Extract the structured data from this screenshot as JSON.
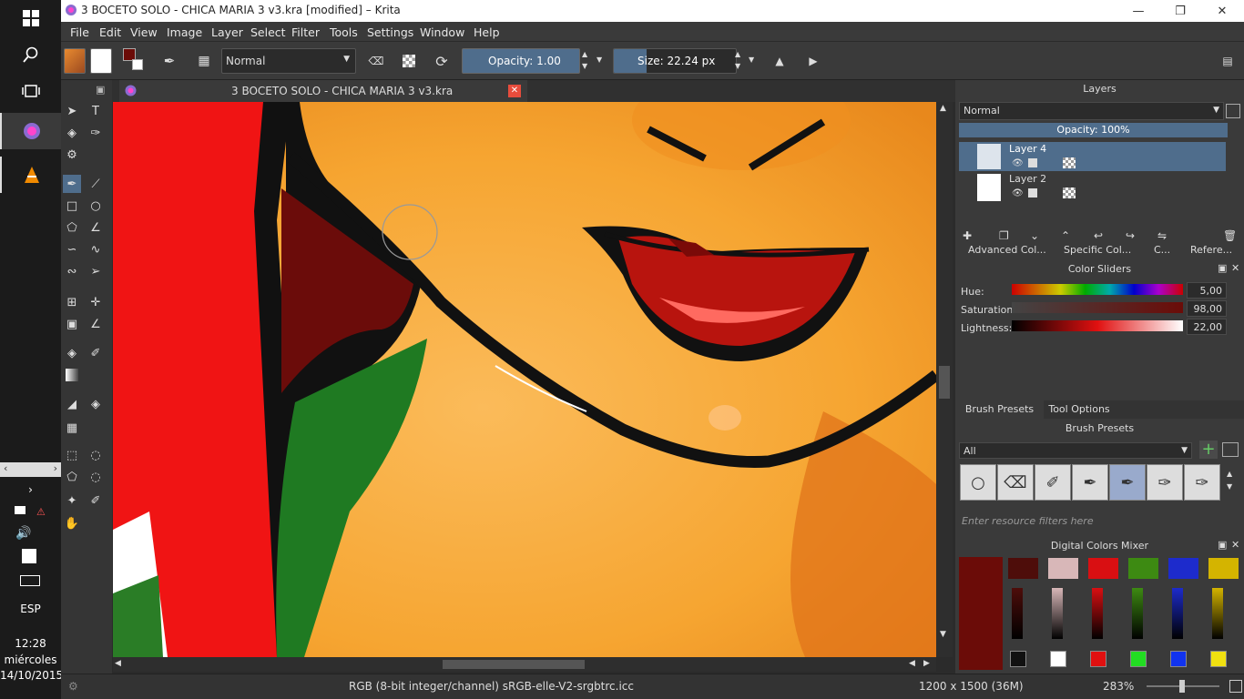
{
  "window": {
    "title": "3 BOCETO SOLO - CHICA MARIA 3 v3.kra [modified] – Krita"
  },
  "menubar": {
    "items": [
      "File",
      "Edit",
      "View",
      "Image",
      "Layer",
      "Select",
      "Filter",
      "Tools",
      "Settings",
      "Window",
      "Help"
    ]
  },
  "toolbar": {
    "blend_mode": "Normal",
    "opacity_label": "Opacity:",
    "opacity_value": "1.00",
    "size_label": "Size:",
    "size_value": "22.24 px"
  },
  "document_tab": {
    "label": "3 BOCETO SOLO - CHICA MARIA 3 v3.kra"
  },
  "layers_panel": {
    "title": "Layers",
    "blend_mode": "Normal",
    "opacity": "Opacity:  100%",
    "layers": [
      {
        "name": "Layer 4",
        "selected": true
      },
      {
        "name": "Layer 2",
        "selected": false
      }
    ],
    "tabs": [
      "Advanced Col...",
      "Specific Col...",
      "C...",
      "Refere..."
    ]
  },
  "color_sliders": {
    "title": "Color Sliders",
    "hue_label": "Hue:",
    "hue_value": "5,00",
    "sat_label": "Saturation:",
    "sat_value": "98,00",
    "light_label": "Lightness:",
    "light_value": "22,00"
  },
  "brush_presets": {
    "tabs": [
      "Brush Presets",
      "Tool Options"
    ],
    "title": "Brush Presets",
    "filter": "All",
    "search_placeholder": "Enter resource filters here"
  },
  "mixer": {
    "title": "Digital Colors Mixer",
    "colors": [
      "#4e0d0a",
      "#d8b7b8",
      "#d90f12",
      "#3d8a12",
      "#1d2bcc",
      "#d4b400"
    ],
    "current": "#6b0c08",
    "bottom": [
      "#111111",
      "#ffffff",
      "#e01010",
      "#22dd22",
      "#1133ee",
      "#f0e010"
    ]
  },
  "statusbar": {
    "colorspace": "RGB (8-bit integer/channel)  sRGB-elle-V2-srgbtrc.icc",
    "dimensions": "1200 x 1500 (36M)",
    "zoom": "283%"
  },
  "taskbar": {
    "lang": "ESP",
    "time": "12:28",
    "day": "miércoles",
    "date": "14/10/2015"
  }
}
